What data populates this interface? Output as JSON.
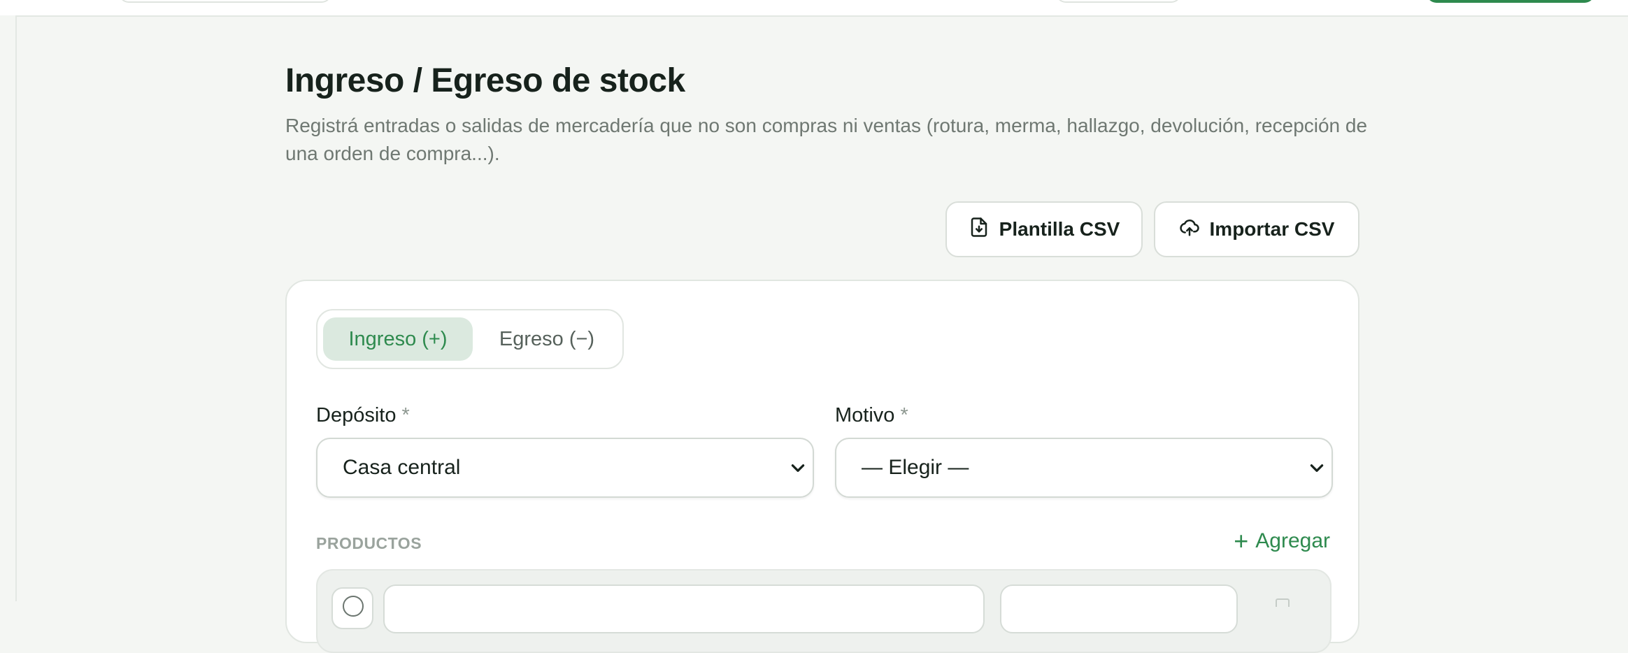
{
  "header": {
    "title": "Ingreso / Egreso de stock",
    "subtitle": "Registrá entradas o salidas de mercadería que no son compras ni ventas (rotura, merma, hallazgo, devolución, recepción de una orden de compra...)."
  },
  "actions": {
    "template_label": "Plantilla CSV",
    "template_icon": "file-download-icon",
    "import_label": "Importar CSV",
    "import_icon": "cloud-upload-icon"
  },
  "movement_type": {
    "options": [
      "Ingreso (+)",
      "Egreso (−)"
    ],
    "selected": "Ingreso (+)"
  },
  "form": {
    "deposito_label": "Depósito",
    "motivo_label": "Motivo",
    "required_mark": "*",
    "deposito_value": "Casa central",
    "motivo_value": "— Elegir —"
  },
  "products": {
    "section_label": "PRODUCTOS",
    "add_label": "Agregar"
  },
  "colors": {
    "accent": "#2e8a4e",
    "accent_soft": "#dbe9df",
    "background": "#f4f6f3"
  }
}
